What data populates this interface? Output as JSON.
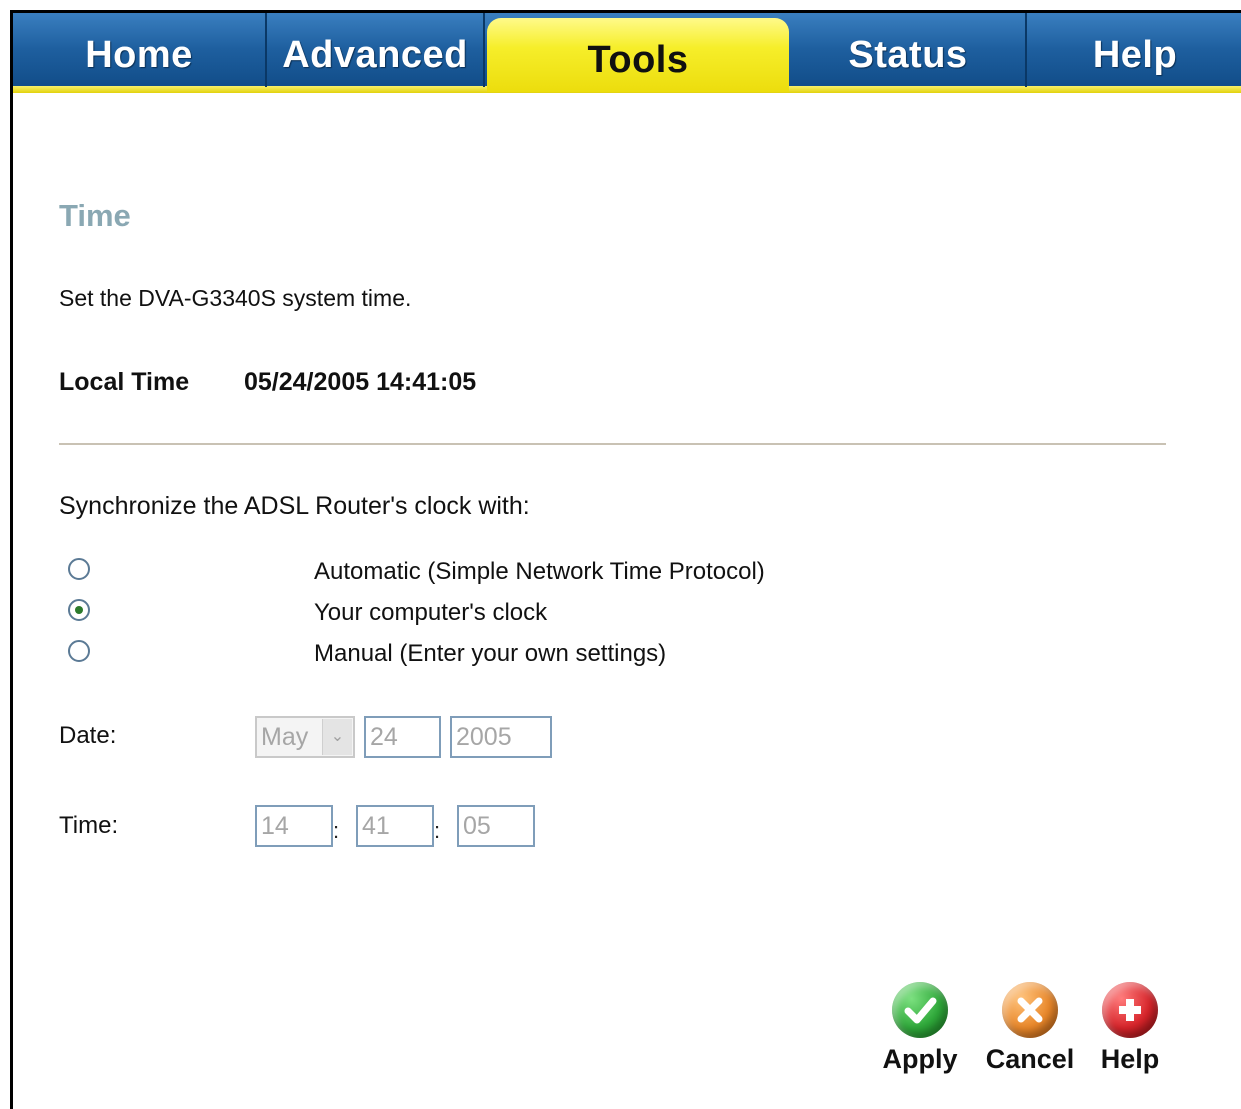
{
  "nav": {
    "tabs": [
      {
        "label": "Home"
      },
      {
        "label": "Advanced"
      },
      {
        "label": "Tools"
      },
      {
        "label": "Status"
      },
      {
        "label": "Help"
      }
    ],
    "active_tab": "Tools"
  },
  "section": {
    "title": "Time",
    "description": "Set the DVA-G3340S system time."
  },
  "local_time": {
    "label": "Local Time",
    "value": "05/24/2005 14:41:05"
  },
  "sync": {
    "label": "Synchronize the ADSL Router's clock with:",
    "options": [
      {
        "label": "Automatic (Simple Network Time Protocol)",
        "selected": false
      },
      {
        "label": "Your computer's clock",
        "selected": true
      },
      {
        "label": "Manual (Enter your own settings)",
        "selected": false
      }
    ]
  },
  "date": {
    "label": "Date:",
    "month": "May",
    "day": "24",
    "year": "2005"
  },
  "time": {
    "label": "Time:",
    "hour": "14",
    "minute": "41",
    "second": "05",
    "separator": ":"
  },
  "buttons": {
    "apply": "Apply",
    "cancel": "Cancel",
    "help": "Help"
  },
  "colors": {
    "tab_blue": "#1e5f9f",
    "tab_active_yellow": "#f6ee2a",
    "section_title": "#8aa8b3",
    "apply_green": "#2fa83a",
    "cancel_orange": "#e8872a",
    "help_red": "#d6242a"
  },
  "icons": {
    "apply": "check-icon",
    "cancel": "x-icon",
    "help": "plus-icon"
  }
}
